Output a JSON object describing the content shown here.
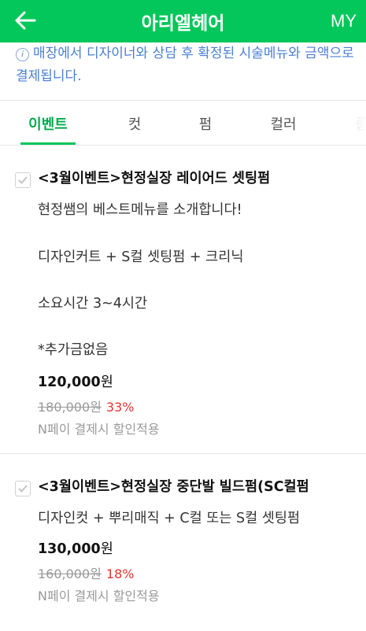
{
  "header": {
    "title": "아리엘헤어",
    "my_label": "MY"
  },
  "notice": {
    "text": "매장에서 디자이너와 상담 후 확정된 시술메뉴와 금액으로 결제됩니다."
  },
  "tabs": [
    {
      "label": "이벤트",
      "active": true
    },
    {
      "label": "컷",
      "active": false
    },
    {
      "label": "펌",
      "active": false
    },
    {
      "label": "컬러",
      "active": false
    },
    {
      "label": "클",
      "active": false
    }
  ],
  "items": [
    {
      "title": "<3월이벤트>현정실장 레이어드 셋팅펌",
      "desc": [
        "현정쌤의 베스트메뉴를 소개합니다!",
        "디자인커트 + S컬 셋팅펌 + 크리닉",
        "소요시간 3~4시간",
        "*추가금없음"
      ],
      "price": "120,000",
      "price_unit": "원",
      "original_price": "180,000원",
      "discount": "33%",
      "npay_note": "N페이 결제시 할인적용"
    },
    {
      "title": "<3월이벤트>현정실장 중단발 빌드펌(SC컬펌",
      "desc": [
        "디자인컷 + 뿌리매직 + C컬 또는 S컬 셋팅펌"
      ],
      "price": "130,000",
      "price_unit": "원",
      "original_price": "160,000원",
      "discount": "18%",
      "npay_note": "N페이 결제시 할인적용"
    }
  ],
  "colors": {
    "brand_green": "#03c75a",
    "notice_blue": "#4a7fd4",
    "discount_red": "#e8322f"
  }
}
